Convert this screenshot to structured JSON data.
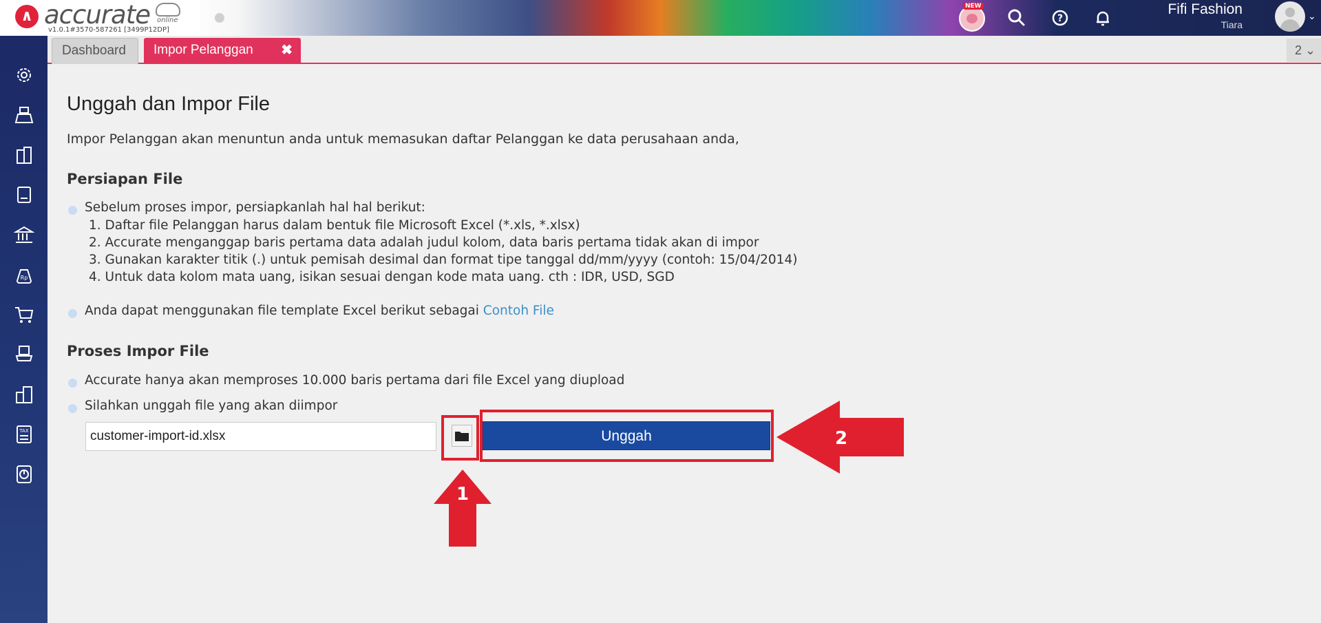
{
  "header": {
    "logo_text": "accurate",
    "logo_sub": "online",
    "version": "v1.0.1#3570-587261 [3499P12DP]",
    "new_badge": "NEW",
    "company_name": "Fifi Fashion",
    "user_name": "Tiara"
  },
  "tabs": [
    {
      "label": "Dashboard"
    },
    {
      "label": "Impor Pelanggan",
      "close": "✖"
    }
  ],
  "tab_count": "2 ⌄",
  "sidebar": {
    "items": [
      {
        "icon": "gear-icon"
      },
      {
        "icon": "cash-register-icon"
      },
      {
        "icon": "building-icon"
      },
      {
        "icon": "book-icon"
      },
      {
        "icon": "bank-icon"
      },
      {
        "icon": "money-bag-icon"
      },
      {
        "icon": "cart-icon"
      },
      {
        "icon": "purchase-cart-icon"
      },
      {
        "icon": "warehouse-icon"
      },
      {
        "icon": "tax-icon"
      },
      {
        "icon": "report-icon"
      }
    ]
  },
  "main": {
    "title": "Unggah dan Impor File",
    "intro": "Impor Pelanggan akan menuntun anda untuk memasukan daftar Pelanggan ke data perusahaan anda,",
    "section1_title": "Persiapan File",
    "s1_bullet1": "Sebelum proses impor, persiapkanlah hal hal berikut:",
    "s1_items": [
      "1. Daftar file Pelanggan harus dalam bentuk file Microsoft Excel (*.xls, *.xlsx)",
      "2. Accurate menganggap baris pertama data adalah judul kolom, data baris pertama tidak akan di impor",
      "3. Gunakan karakter titik (.) untuk pemisah desimal dan format tipe tanggal dd/mm/yyyy (contoh: 15/04/2014)",
      "4. Untuk data kolom mata uang, isikan sesuai dengan kode mata uang. cth : IDR, USD, SGD"
    ],
    "s1_bullet2_text": "Anda dapat menggunakan file template Excel berikut sebagai ",
    "s1_bullet2_link": "Contoh File",
    "section2_title": "Proses Impor File",
    "s2_bullet1": "Accurate hanya akan memproses 10.000 baris pertama dari file Excel yang diupload",
    "s2_bullet2": "Silahkan unggah file yang akan diimpor",
    "file_value": "customer-import-id.xlsx",
    "upload_label": "Unggah",
    "annotation_1": "1",
    "annotation_2": "2"
  },
  "colors": {
    "accent": "#e0325c",
    "button": "#1a4aa0",
    "annotation": "#e0202e",
    "link": "#3a8fc7",
    "sidebar": "#1c2a66"
  }
}
